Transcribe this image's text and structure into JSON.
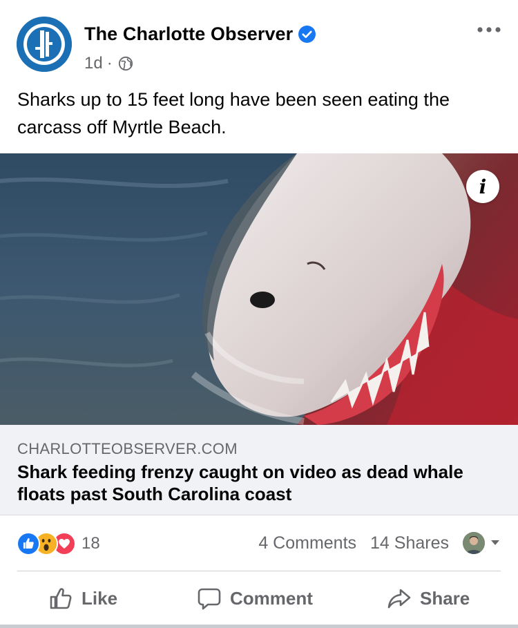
{
  "post": {
    "page_name": "The Charlotte Observer",
    "time": "1d",
    "dot": "·",
    "caption": "Sharks up to 15 feet long have been seen eating the carcass off Myrtle Beach."
  },
  "link": {
    "domain": "CHARLOTTEOBSERVER.COM",
    "headline": "Shark feeding frenzy caught on video as dead whale floats past South Carolina coast",
    "info_glyph": "i"
  },
  "stats": {
    "reaction_count": "18",
    "comments": "4 Comments",
    "shares": "14 Shares"
  },
  "actions": {
    "like": "Like",
    "comment": "Comment",
    "share": "Share"
  },
  "colors": {
    "brand_blue": "#1b6fb5",
    "verified_blue": "#1877f2",
    "like_blue": "#1877f2",
    "love_red": "#f33e58",
    "wow_yellow": "#f7b125",
    "secondary_text": "#65676b"
  },
  "icons": [
    "observer-logo-icon",
    "verified-badge-icon",
    "globe-icon",
    "more-options-icon",
    "info-icon",
    "like-reaction-icon",
    "wow-reaction-icon",
    "love-reaction-icon",
    "thumbs-up-icon",
    "comment-icon",
    "share-arrow-icon",
    "chevron-down-icon"
  ]
}
